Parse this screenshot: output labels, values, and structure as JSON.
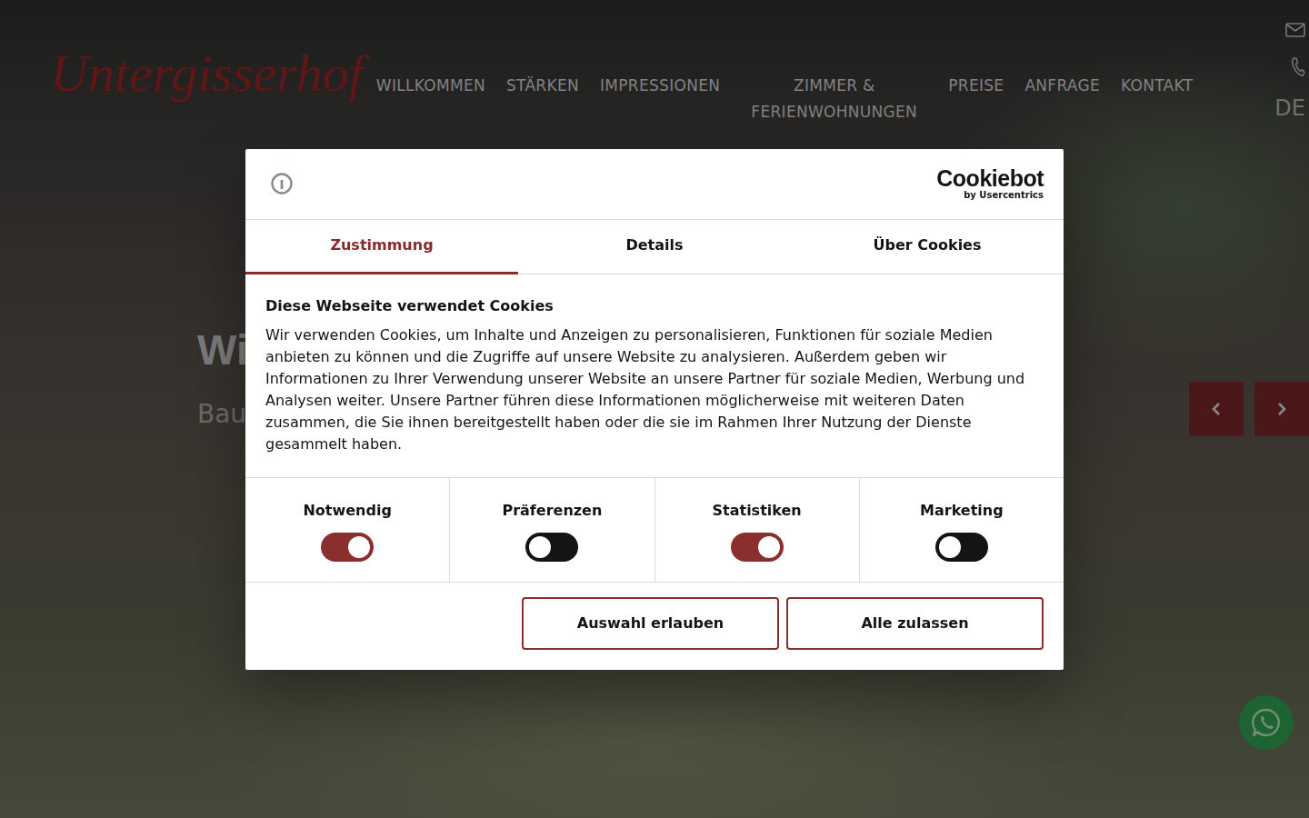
{
  "site": {
    "logo": "Untergisserhof",
    "nav": [
      "WILLKOMMEN",
      "STÄRKEN",
      "IMPRESSIONEN",
      "ZIMMER & FERIENWOHNUNGEN",
      "PREISE",
      "ANFRAGE",
      "KONTAKT"
    ],
    "language": "DE"
  },
  "hero": {
    "title": "Will",
    "subtitle": "Bau"
  },
  "consent": {
    "brand": "Cookiebot",
    "brand_sub": "by Usercentrics",
    "tabs": [
      {
        "label": "Zustimmung",
        "selected": true
      },
      {
        "label": "Details",
        "selected": false
      },
      {
        "label": "Über Cookies",
        "selected": false
      }
    ],
    "heading": "Diese Webseite verwendet Cookies",
    "text": "Wir verwenden Cookies, um Inhalte und Anzeigen zu personalisieren, Funktionen für soziale Medien anbieten zu können und die Zugriffe auf unsere Website zu analysieren. Außerdem geben wir Informationen zu Ihrer Verwendung unserer Website an unsere Partner für soziale Medien, Werbung und Analysen weiter. Unsere Partner führen diese Informationen möglicherweise mit weiteren Daten zusammen, die Sie ihnen bereitgestellt haben oder die sie im Rahmen Ihrer Nutzung der Dienste gesammelt haben.",
    "categories": [
      {
        "label": "Notwendig",
        "on": true
      },
      {
        "label": "Präferenzen",
        "on": false
      },
      {
        "label": "Statistiken",
        "on": true
      },
      {
        "label": "Marketing",
        "on": false
      }
    ],
    "buttons": [
      "Auswahl erlauben",
      "Alle zulassen"
    ]
  }
}
